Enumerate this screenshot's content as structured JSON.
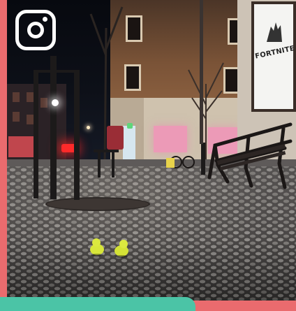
{
  "image": {
    "description_tags": [
      "night-street",
      "cobblestone",
      "benches",
      "yellow-duck-figurines"
    ],
    "overlay_icon": "instagram-icon",
    "billboard_text": "FORTNITE"
  },
  "colors": {
    "frame": "#ea6b6e",
    "tab": "#4bc4a6",
    "duck": "#d8e63a"
  }
}
